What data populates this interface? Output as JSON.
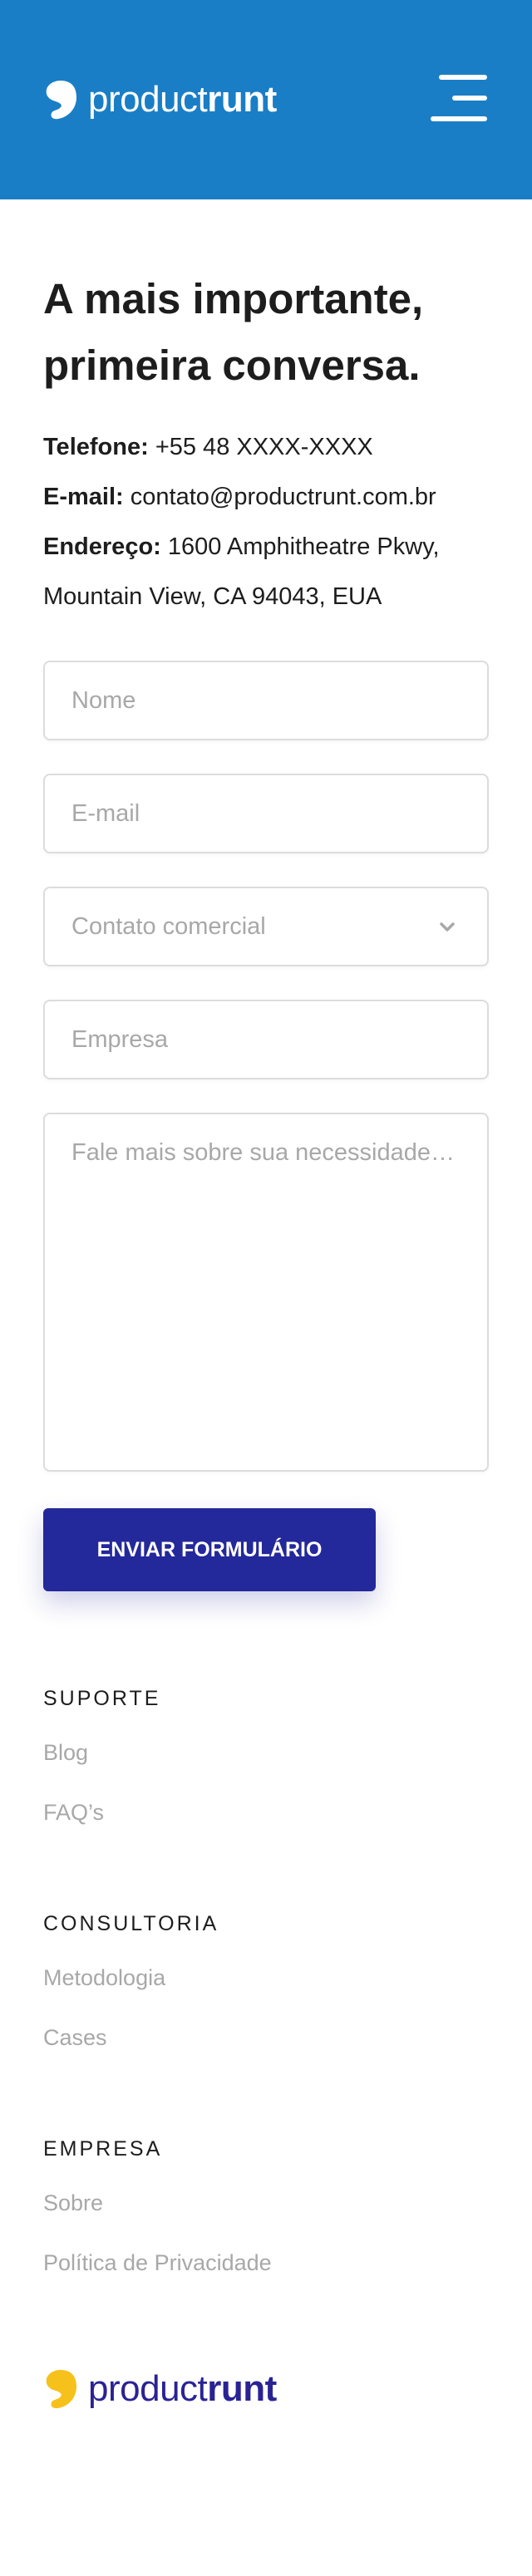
{
  "header": {
    "logo": {
      "light": "product",
      "bold": "runt",
      "icon": "leaf-icon",
      "color": "#ffffff"
    },
    "menu_icon": "hamburger-menu-icon",
    "background": "#1a7ec6"
  },
  "contact": {
    "title_line1": "A mais importante,",
    "title_line2": "primeira conversa.",
    "phone_label": "Telefone:",
    "phone_value": "+55 48 XXXX-XXXX",
    "email_label": "E-mail:",
    "email_value": "contato@productrunt.com.br",
    "address_label": "Endereço:",
    "address_line1": "1600 Amphitheatre Pkwy,",
    "address_line2": "Mountain View, CA 94043, EUA"
  },
  "form": {
    "name_placeholder": "Nome",
    "email_placeholder": "E-mail",
    "subject_selected": "Contato comercial",
    "company_placeholder": "Empresa",
    "message_placeholder": "Fale mais sobre sua necessidade…",
    "submit_label": "ENVIAR FORMULÁRIO",
    "submit_color": "#23289a"
  },
  "footer": {
    "sections": [
      {
        "heading": "SUPORTE",
        "links": [
          "Blog",
          "FAQ’s"
        ]
      },
      {
        "heading": "CONSULTORIA",
        "links": [
          "Metodologia",
          "Cases"
        ]
      },
      {
        "heading": "EMPRESA",
        "links": [
          "Sobre",
          "Política de Privacidade"
        ]
      }
    ],
    "logo": {
      "light": "product",
      "bold": "runt",
      "icon": "leaf-icon",
      "icon_color": "#f6c11a",
      "text_color": "#2a2394"
    }
  }
}
